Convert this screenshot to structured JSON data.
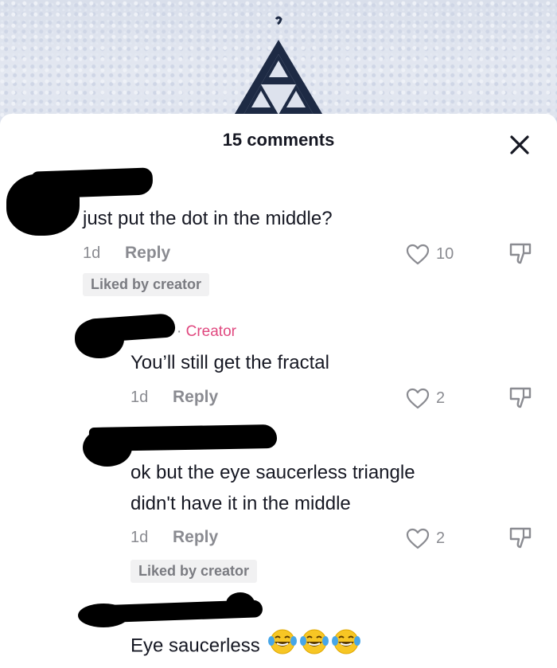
{
  "sheet": {
    "title": "15 comments"
  },
  "comments": [
    {
      "text": "just put the dot in the middle?",
      "time": "1d",
      "reply_label": "Reply",
      "likes": "10",
      "badge": "Liked by creator"
    },
    {
      "creator_label": "Creator",
      "creator_sep": "·",
      "text": "You’ll still get the fractal",
      "time": "1d",
      "reply_label": "Reply",
      "likes": "2"
    },
    {
      "text_line1": "ok but the eye saucerless triangle",
      "text_line2": "didn't have it in the middle",
      "time": "1d",
      "reply_label": "Reply",
      "likes": "2",
      "badge": "Liked by creator"
    },
    {
      "text": "Eye saucerless",
      "emoji": "laughing-crying-face"
    }
  ],
  "colors": {
    "creator_accent": "#e0487f",
    "meta_gray": "#8a8b91",
    "badge_bg": "#f1f1f2"
  }
}
